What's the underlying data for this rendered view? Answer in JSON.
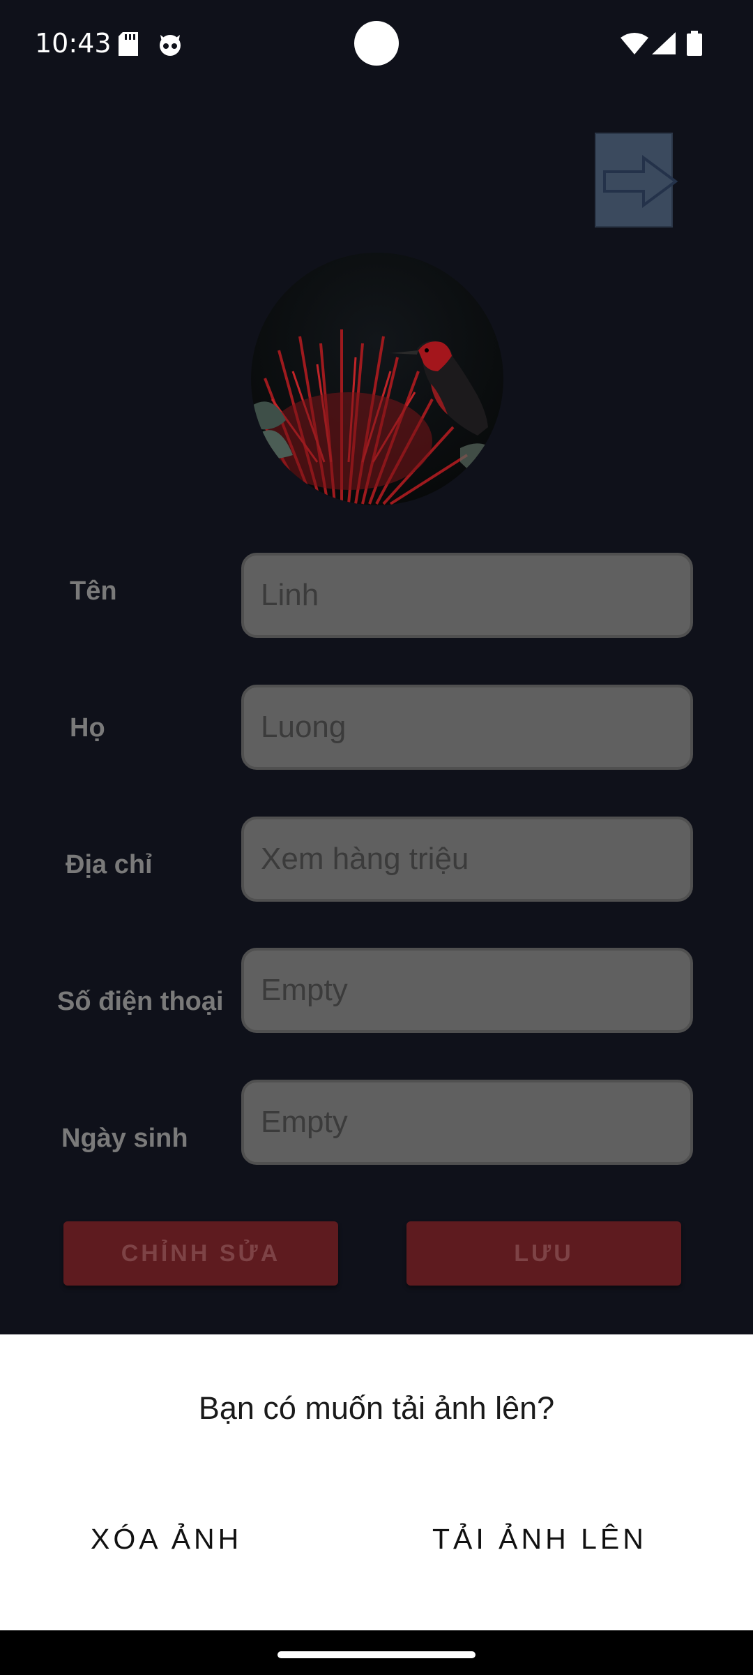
{
  "status_bar": {
    "time": "10:43",
    "icons": [
      "sd-card-icon",
      "cat-icon",
      "wifi-icon",
      "cell-signal-icon",
      "battery-icon"
    ]
  },
  "header": {
    "logout_icon": "arrow-right-icon"
  },
  "profile": {
    "fields": [
      {
        "label": "Tên",
        "value": "Linh"
      },
      {
        "label": "Họ",
        "value": "Luong"
      },
      {
        "label": "Địa chỉ",
        "value": "Xem hàng triệu"
      },
      {
        "label": "Số điện thoại",
        "value": "Empty"
      },
      {
        "label": "Ngày sinh",
        "value": "Empty"
      }
    ],
    "edit_label": "CHỈNH SỬA",
    "save_label": "LƯU"
  },
  "dialog": {
    "title": "Bạn có muốn tải ảnh lên?",
    "delete_label": "XÓA ẢNH",
    "upload_label": "TẢI ẢNH LÊN"
  },
  "colors": {
    "background": "#0f111a",
    "input_fill": "#606060",
    "button_fill": "#5e1b1f",
    "dialog_bg": "#ffffff",
    "logout_button": "#3b4a5e"
  }
}
